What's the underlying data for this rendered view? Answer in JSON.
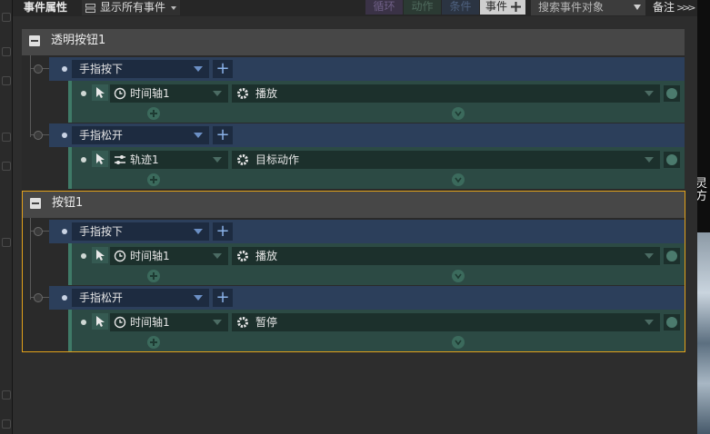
{
  "toolbar": {
    "title": "事件属性",
    "show_all": "显示所有事件",
    "tags": {
      "loop": "循环",
      "action": "动作",
      "condition": "条件",
      "event": "事件"
    },
    "search_placeholder": "搜索事件对象",
    "notes": "备注"
  },
  "right_strip_text": "灵方",
  "groups": [
    {
      "title": "透明按钮1",
      "triggers": [
        {
          "name": "手指按下",
          "actions": [
            {
              "object": "时间轴1",
              "object_icon": "clock-icon",
              "action": "播放"
            }
          ]
        },
        {
          "name": "手指松开",
          "actions": [
            {
              "object": "轨迹1",
              "object_icon": "path-icon",
              "action": "目标动作"
            }
          ]
        }
      ]
    },
    {
      "title": "按钮1",
      "selected": true,
      "triggers": [
        {
          "name": "手指按下",
          "actions": [
            {
              "object": "时间轴1",
              "object_icon": "clock-icon",
              "action": "播放"
            }
          ]
        },
        {
          "name": "手指松开",
          "actions": [
            {
              "object": "时间轴1",
              "object_icon": "clock-icon",
              "action": "暂停"
            }
          ]
        }
      ]
    }
  ],
  "colors": {
    "selection_border": "#e3a21a",
    "trigger_row": "#2c3f5b",
    "action_row": "#2c4a44"
  }
}
